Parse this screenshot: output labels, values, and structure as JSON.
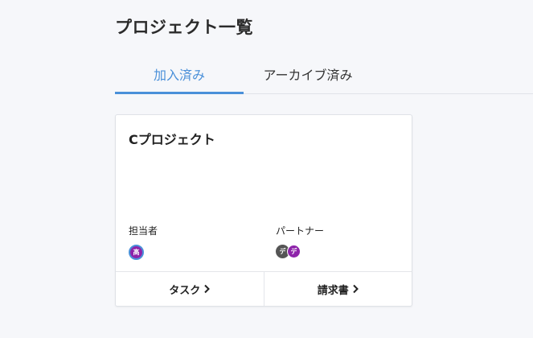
{
  "page": {
    "title": "プロジェクト一覧"
  },
  "tabs": [
    {
      "label": "加入済み",
      "active": true
    },
    {
      "label": "アーカイブ済み",
      "active": false
    }
  ],
  "colors": {
    "accent": "#4a90d9"
  },
  "project_card": {
    "title": "Cプロジェクト",
    "assignee": {
      "label": "担当者",
      "avatars": [
        {
          "initial": "髙",
          "color": "#8e24aa"
        }
      ]
    },
    "partner": {
      "label": "パートナー",
      "avatars": [
        {
          "initial": "デ",
          "color": "#555555"
        },
        {
          "initial": "デ",
          "color": "#8e24aa"
        }
      ]
    },
    "footer": {
      "task_label": "タスク",
      "invoice_label": "請求書",
      "icon": "chevron-right-icon"
    }
  }
}
